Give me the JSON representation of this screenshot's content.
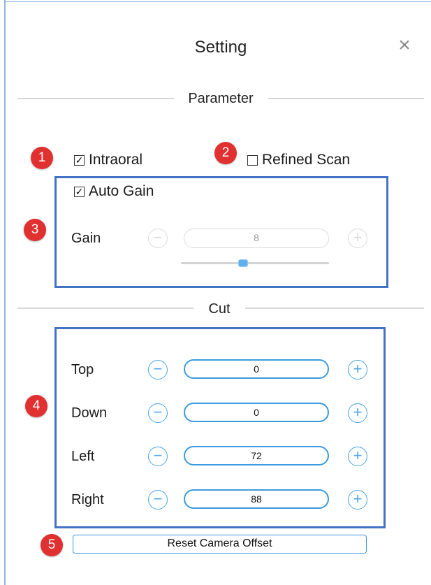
{
  "dialog": {
    "title": "Setting",
    "close_icon": "close-icon"
  },
  "parameter": {
    "section_title": "Parameter",
    "intraoral": {
      "label": "Intraoral",
      "checked": true
    },
    "refined_scan": {
      "label": "Refined Scan",
      "checked": false
    },
    "auto_gain": {
      "label": "Auto Gain",
      "checked": true
    },
    "gain": {
      "label": "Gain",
      "value": "8",
      "minus": "−",
      "plus": "+",
      "slider_fraction": 0.42
    }
  },
  "cut": {
    "section_title": "Cut",
    "rows": [
      {
        "label": "Top",
        "value": "0"
      },
      {
        "label": "Down",
        "value": "0"
      },
      {
        "label": "Left",
        "value": "72"
      },
      {
        "label": "Right",
        "value": "88"
      }
    ],
    "minus": "−",
    "plus": "+"
  },
  "reset_button": {
    "label": "Reset Camera Offset"
  },
  "badges": [
    "1",
    "2",
    "3",
    "4",
    "5"
  ],
  "colors": {
    "accent": "#3a9be0",
    "badge": "#e03030",
    "highlight_box": "#4472c4",
    "disabled": "#dadada"
  }
}
